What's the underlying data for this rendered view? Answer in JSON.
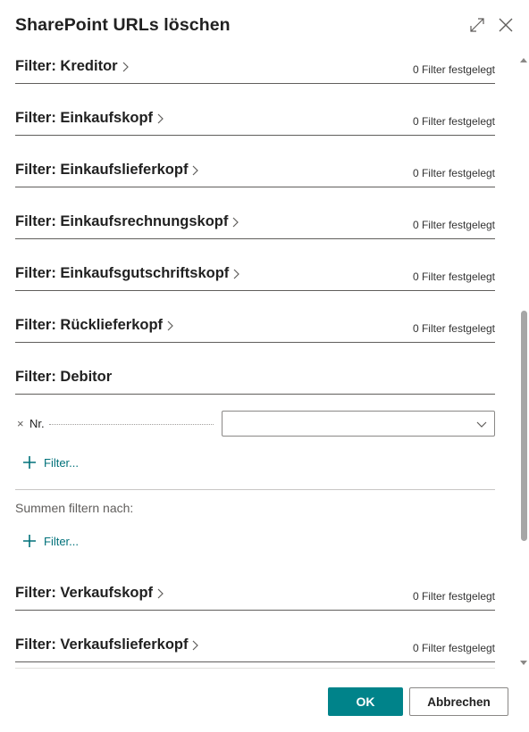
{
  "dialog": {
    "title": "SharePoint URLs löschen"
  },
  "groups": [
    {
      "label": "Filter: Kreditor",
      "status": "0 Filter festgelegt"
    },
    {
      "label": "Filter: Einkaufskopf",
      "status": "0 Filter festgelegt"
    },
    {
      "label": "Filter: Einkaufslieferkopf",
      "status": "0 Filter festgelegt"
    },
    {
      "label": "Filter: Einkaufsrechnungskopf",
      "status": "0 Filter festgelegt"
    },
    {
      "label": "Filter: Einkaufsgutschriftskopf",
      "status": "0 Filter festgelegt"
    },
    {
      "label": "Filter: Rücklieferkopf",
      "status": "0 Filter festgelegt"
    },
    {
      "label": "Filter: Debitor",
      "status": ""
    },
    {
      "label": "Filter: Verkaufskopf",
      "status": "0 Filter festgelegt"
    },
    {
      "label": "Filter: Verkaufslieferkopf",
      "status": "0 Filter festgelegt"
    }
  ],
  "debitor": {
    "remove_glyph": "×",
    "field_label": "Nr.",
    "field_value": "",
    "add_filter_label": "Filter...",
    "sum_label": "Summen filtern nach:",
    "sum_add_filter_label": "Filter..."
  },
  "footer": {
    "ok_label": "OK",
    "cancel_label": "Abbrechen"
  },
  "colors": {
    "accent": "#00838a",
    "link": "#00717a"
  }
}
